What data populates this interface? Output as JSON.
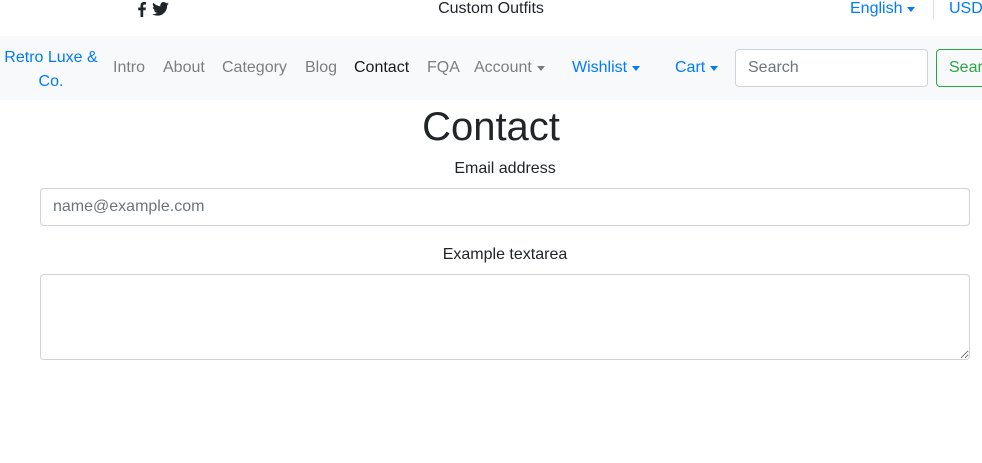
{
  "topbar": {
    "social_icons": [
      "facebook-icon",
      "twitter-icon"
    ],
    "tagline": "Custom Outfits",
    "language": "English",
    "currency": "USD"
  },
  "navbar": {
    "brand": "Retro Luxe & Co.",
    "items": [
      {
        "label": "Intro"
      },
      {
        "label": "About"
      },
      {
        "label": "Category"
      },
      {
        "label": "Blog"
      },
      {
        "label": "Contact",
        "active": true
      },
      {
        "label": "FQA"
      },
      {
        "label": "Account",
        "dropdown": true
      }
    ],
    "wishlist": "Wishlist",
    "cart": "Cart",
    "search": {
      "placeholder": "Search",
      "value": "",
      "button_label": "Search"
    }
  },
  "main": {
    "title": "Contact",
    "email": {
      "label": "Email address",
      "placeholder": "name@example.com",
      "value": ""
    },
    "textarea": {
      "label": "Example textarea",
      "value": ""
    }
  },
  "colors": {
    "link": "#007bff",
    "navbar_bg": "#f8f9fa",
    "success": "#28a745",
    "border": "#ced4da"
  }
}
